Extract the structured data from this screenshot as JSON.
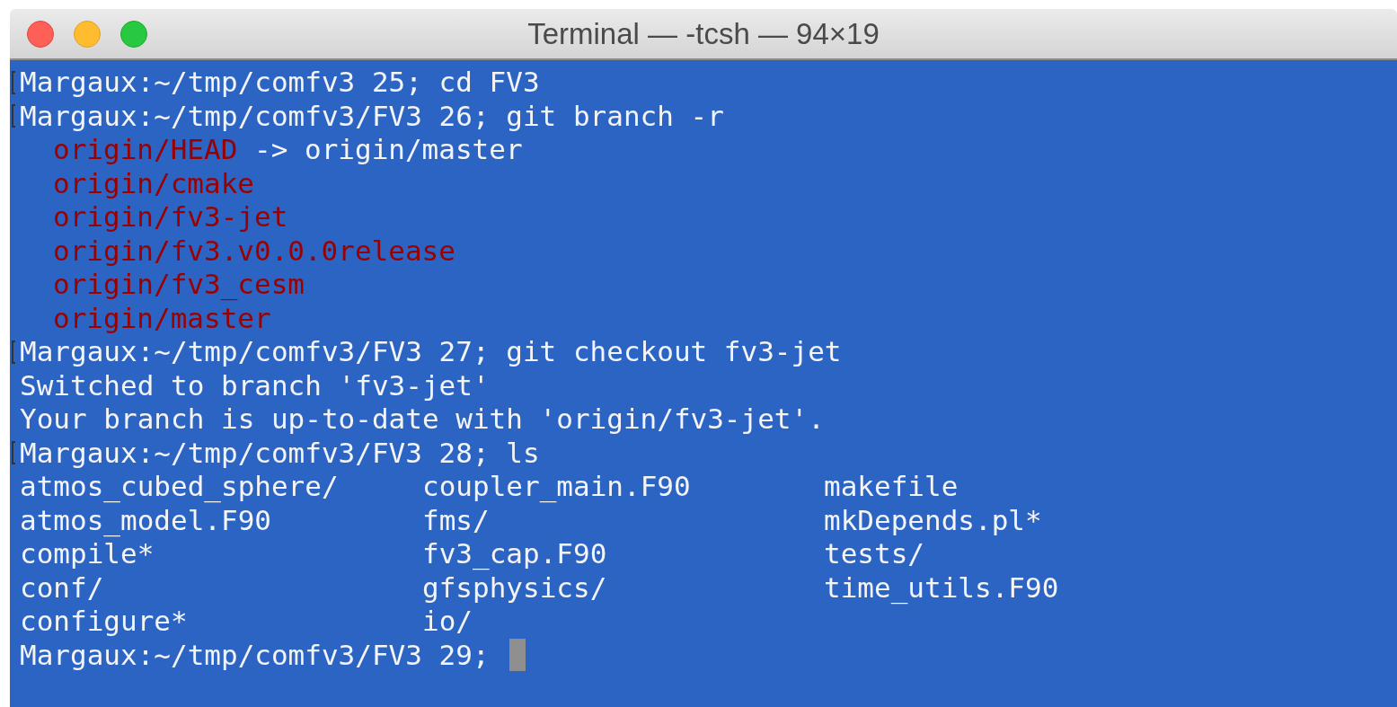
{
  "window": {
    "title": "Terminal — -tcsh — 94×19"
  },
  "lines": [
    {
      "kind": "prompt",
      "text": "Margaux:~/tmp/comfv3 25; cd FV3",
      "marked": true
    },
    {
      "kind": "prompt",
      "text": "Margaux:~/tmp/comfv3/FV3 26; git branch -r",
      "marked": true
    },
    {
      "kind": "branch",
      "name": "origin/HEAD",
      "suffix": "-> origin/master"
    },
    {
      "kind": "branch",
      "name": "origin/cmake"
    },
    {
      "kind": "branch",
      "name": "origin/fv3-jet"
    },
    {
      "kind": "branch",
      "name": "origin/fv3.v0.0.0release"
    },
    {
      "kind": "branch",
      "name": "origin/fv3_cesm"
    },
    {
      "kind": "branch",
      "name": "origin/master"
    },
    {
      "kind": "prompt",
      "text": "Margaux:~/tmp/comfv3/FV3 27; git checkout fv3-jet",
      "marked": true
    },
    {
      "kind": "output",
      "text": "Switched to branch 'fv3-jet'"
    },
    {
      "kind": "output",
      "text": "Your branch is up-to-date with 'origin/fv3-jet'."
    },
    {
      "kind": "prompt",
      "text": "Margaux:~/tmp/comfv3/FV3 28; ls",
      "marked": true
    },
    {
      "kind": "listing",
      "cells": [
        "atmos_cubed_sphere/",
        "coupler_main.F90",
        "makefile"
      ]
    },
    {
      "kind": "listing",
      "cells": [
        "atmos_model.F90",
        "fms/",
        "mkDepends.pl*"
      ]
    },
    {
      "kind": "listing",
      "cells": [
        "compile*",
        "fv3_cap.F90",
        "tests/"
      ]
    },
    {
      "kind": "listing",
      "cells": [
        "conf/",
        "gfsphysics/",
        "time_utils.F90"
      ]
    },
    {
      "kind": "listing",
      "cells": [
        "configure*",
        "io/"
      ]
    },
    {
      "kind": "prompt",
      "text": "Margaux:~/tmp/comfv3/FV3 29;",
      "marked": false,
      "cursor": true
    }
  ]
}
